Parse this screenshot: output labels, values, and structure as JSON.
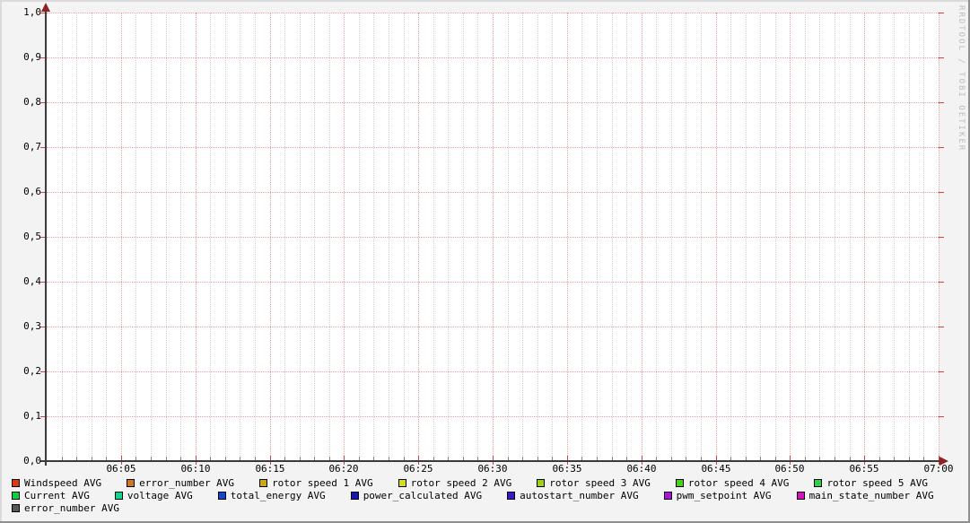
{
  "watermark": "RRDTOOL / TOBI OETIKER",
  "chart_data": {
    "type": "line",
    "title": "",
    "no_data_plotted": true,
    "x_axis": {
      "tick_labels": [
        "06:05",
        "06:10",
        "06:15",
        "06:20",
        "06:25",
        "06:30",
        "06:35",
        "06:40",
        "06:45",
        "06:50",
        "06:55",
        "07:00"
      ],
      "range_minutes": 60,
      "major_every_minutes": 5,
      "minor_every_minutes": 1
    },
    "y_axis": {
      "tick_labels": [
        "1,0",
        "0,9",
        "0,8",
        "0,7",
        "0,6",
        "0,5",
        "0,4",
        "0,3",
        "0,2",
        "0,1",
        "0,0"
      ],
      "min": 0.0,
      "max": 1.0,
      "step": 0.1,
      "decimal_separator": ","
    },
    "grid": {
      "major_color": "#f0a0a0",
      "minor_color": "#d2d2d2",
      "tick_color": "#d94040",
      "minor_tick_color": "#808080",
      "axis_color": "#3a3a3a",
      "arrow_color": "#8b2323",
      "plot_background": "#ffffff",
      "outer_background": "#f3f3f3"
    },
    "legend_position": "bottom",
    "series": [
      {
        "label": "Windspeed AVG",
        "color": "#e0380e",
        "row": 0,
        "values": []
      },
      {
        "label": "error_number AVG",
        "color": "#d2761c",
        "row": 0,
        "values": []
      },
      {
        "label": "rotor speed 1 AVG",
        "color": "#cea80a",
        "row": 0,
        "values": []
      },
      {
        "label": "rotor speed 2 AVG",
        "color": "#d4dc1e",
        "row": 0,
        "values": []
      },
      {
        "label": "rotor speed 3 AVG",
        "color": "#9cd40e",
        "row": 0,
        "values": []
      },
      {
        "label": "rotor speed 4 AVG",
        "color": "#46d312",
        "row": 0,
        "values": []
      },
      {
        "label": "rotor speed 5 AVG",
        "color": "#2bd14b",
        "row": 0,
        "values": []
      },
      {
        "label": "Current AVG",
        "color": "#0bd439",
        "row": 1,
        "values": []
      },
      {
        "label": "voltage AVG",
        "color": "#0dd596",
        "row": 1,
        "values": []
      },
      {
        "label": "total_energy AVG",
        "color": "#1347d1",
        "row": 1,
        "values": []
      },
      {
        "label": "power_calculated AVG",
        "color": "#1517b5",
        "row": 1,
        "values": []
      },
      {
        "label": "autostart_number AVG",
        "color": "#3a17c9",
        "row": 1,
        "values": []
      },
      {
        "label": "pwm_setpoint AVG",
        "color": "#ac12dc",
        "row": 1,
        "values": []
      },
      {
        "label": "main_state_number AVG",
        "color": "#d512bd",
        "row": 1,
        "values": []
      },
      {
        "label": "error_number AVG",
        "color": "#58585b",
        "row": 2,
        "values": []
      }
    ]
  }
}
